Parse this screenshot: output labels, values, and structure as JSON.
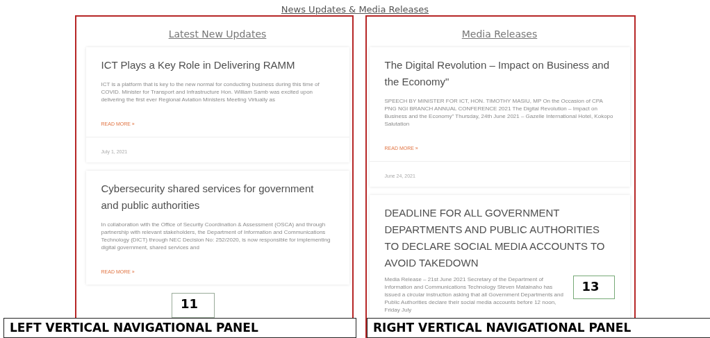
{
  "page_title": "News Updates & Media Releases",
  "columns": [
    {
      "heading": "Latest New Updates",
      "posts": [
        {
          "title": "ICT Plays a Key Role in Delivering RAMM",
          "excerpt": "ICT is a platform that is key to the new normal for conducting business during this time of COVID. Minister for Transport and Infrastructure Hon. William Samb was excited upon delivering the first ever Regional Aviation Ministers Meeting Virtually as",
          "link": "READ MORE »",
          "date": "July 1, 2021"
        },
        {
          "title": "Cybersecurity shared services for government and public authorities",
          "excerpt": "In collaboration with the Office of Security Coordination & Assessment (OSCA) and through partnership with relevant stakeholders, the Department of Information and Communications Technology (DICT) through NEC Decision No: 252/2020, is now responsible for implementing digital government, shared services and",
          "link": "READ MORE »"
        }
      ],
      "callout": {
        "number": "11",
        "label": "LEFT VERTICAL NAVIGATIONAL PANEL"
      }
    },
    {
      "heading": "Media Releases",
      "posts": [
        {
          "title": "The Digital Revolution – Impact on Business and the Economy\"",
          "excerpt": "SPEECH BY MINISTER FOR ICT, HON. TIMOTHY MASIU, MP On the Occasion of CPA PNG NGI BRANCH ANNUAL CONFERENCE 2021 The Digital Revolution – Impact on Business and the Economy\" Thursday, 24th June 2021 – Gazelle International Hotel, Kokopo Salutation",
          "link": "READ MORE »",
          "date": "June 24, 2021"
        },
        {
          "title": "DEADLINE FOR ALL GOVERNMENT DEPARTMENTS AND PUBLIC AUTHORITIES TO DECLARE SOCIAL MEDIA ACCOUNTS TO AVOID TAKEDOWN",
          "excerpt": "Media Release – 21st June 2021 Secretary of the Department of Information and Communications Technology Steven Matainaho has issued a circular instruction asking that all Government Departments and Public Authorities declare their social media accounts before 12 noon, Friday July"
        }
      ],
      "callout": {
        "number": "13",
        "label": "RIGHT VERTICAL NAVIGATIONAL PANEL"
      }
    }
  ]
}
